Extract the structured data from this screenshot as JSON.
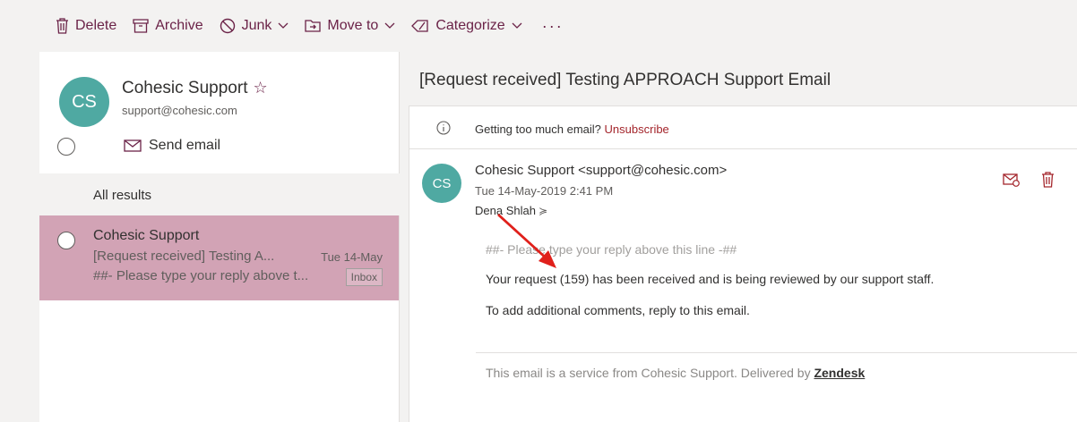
{
  "toolbar": {
    "delete_label": "Delete",
    "archive_label": "Archive",
    "junk_label": "Junk",
    "move_label": "Move to",
    "categorize_label": "Categorize",
    "more_label": "···"
  },
  "contact": {
    "initials": "CS",
    "name": "Cohesic Support",
    "star": "☆",
    "email": "support@cohesic.com",
    "send_email_label": "Send email"
  },
  "results": {
    "header": "All results",
    "items": [
      {
        "sender": "Cohesic Support",
        "subject": "[Request received] Testing A...",
        "date": "Tue 14-May",
        "preview": "##- Please type your reply above t...",
        "tag": "Inbox"
      }
    ]
  },
  "reading": {
    "title": "[Request received] Testing APPROACH Support Email",
    "unsubscribe_prompt": "Getting too much email?",
    "unsubscribe_link": "Unsubscribe",
    "sender_initials": "CS",
    "sender": "Cohesic Support <support@cohesic.com>",
    "sent": "Tue 14-May-2019 2:41 PM",
    "recipient": "Dena Shlah",
    "body_separator": "##- Please type your reply above this line -##",
    "body_p1": "Your request (159) has been received and is being reviewed by our support staff.",
    "body_p2": "To add additional comments, reply to this email.",
    "footer_text": "This email is a service from Cohesic Support. Delivered by",
    "footer_link": "Zendesk"
  },
  "colors": {
    "accent": "#6b2348",
    "selected_row": "#d2a3b5",
    "avatar": "#4fa9a2",
    "annotation_arrow": "#e0201b"
  }
}
